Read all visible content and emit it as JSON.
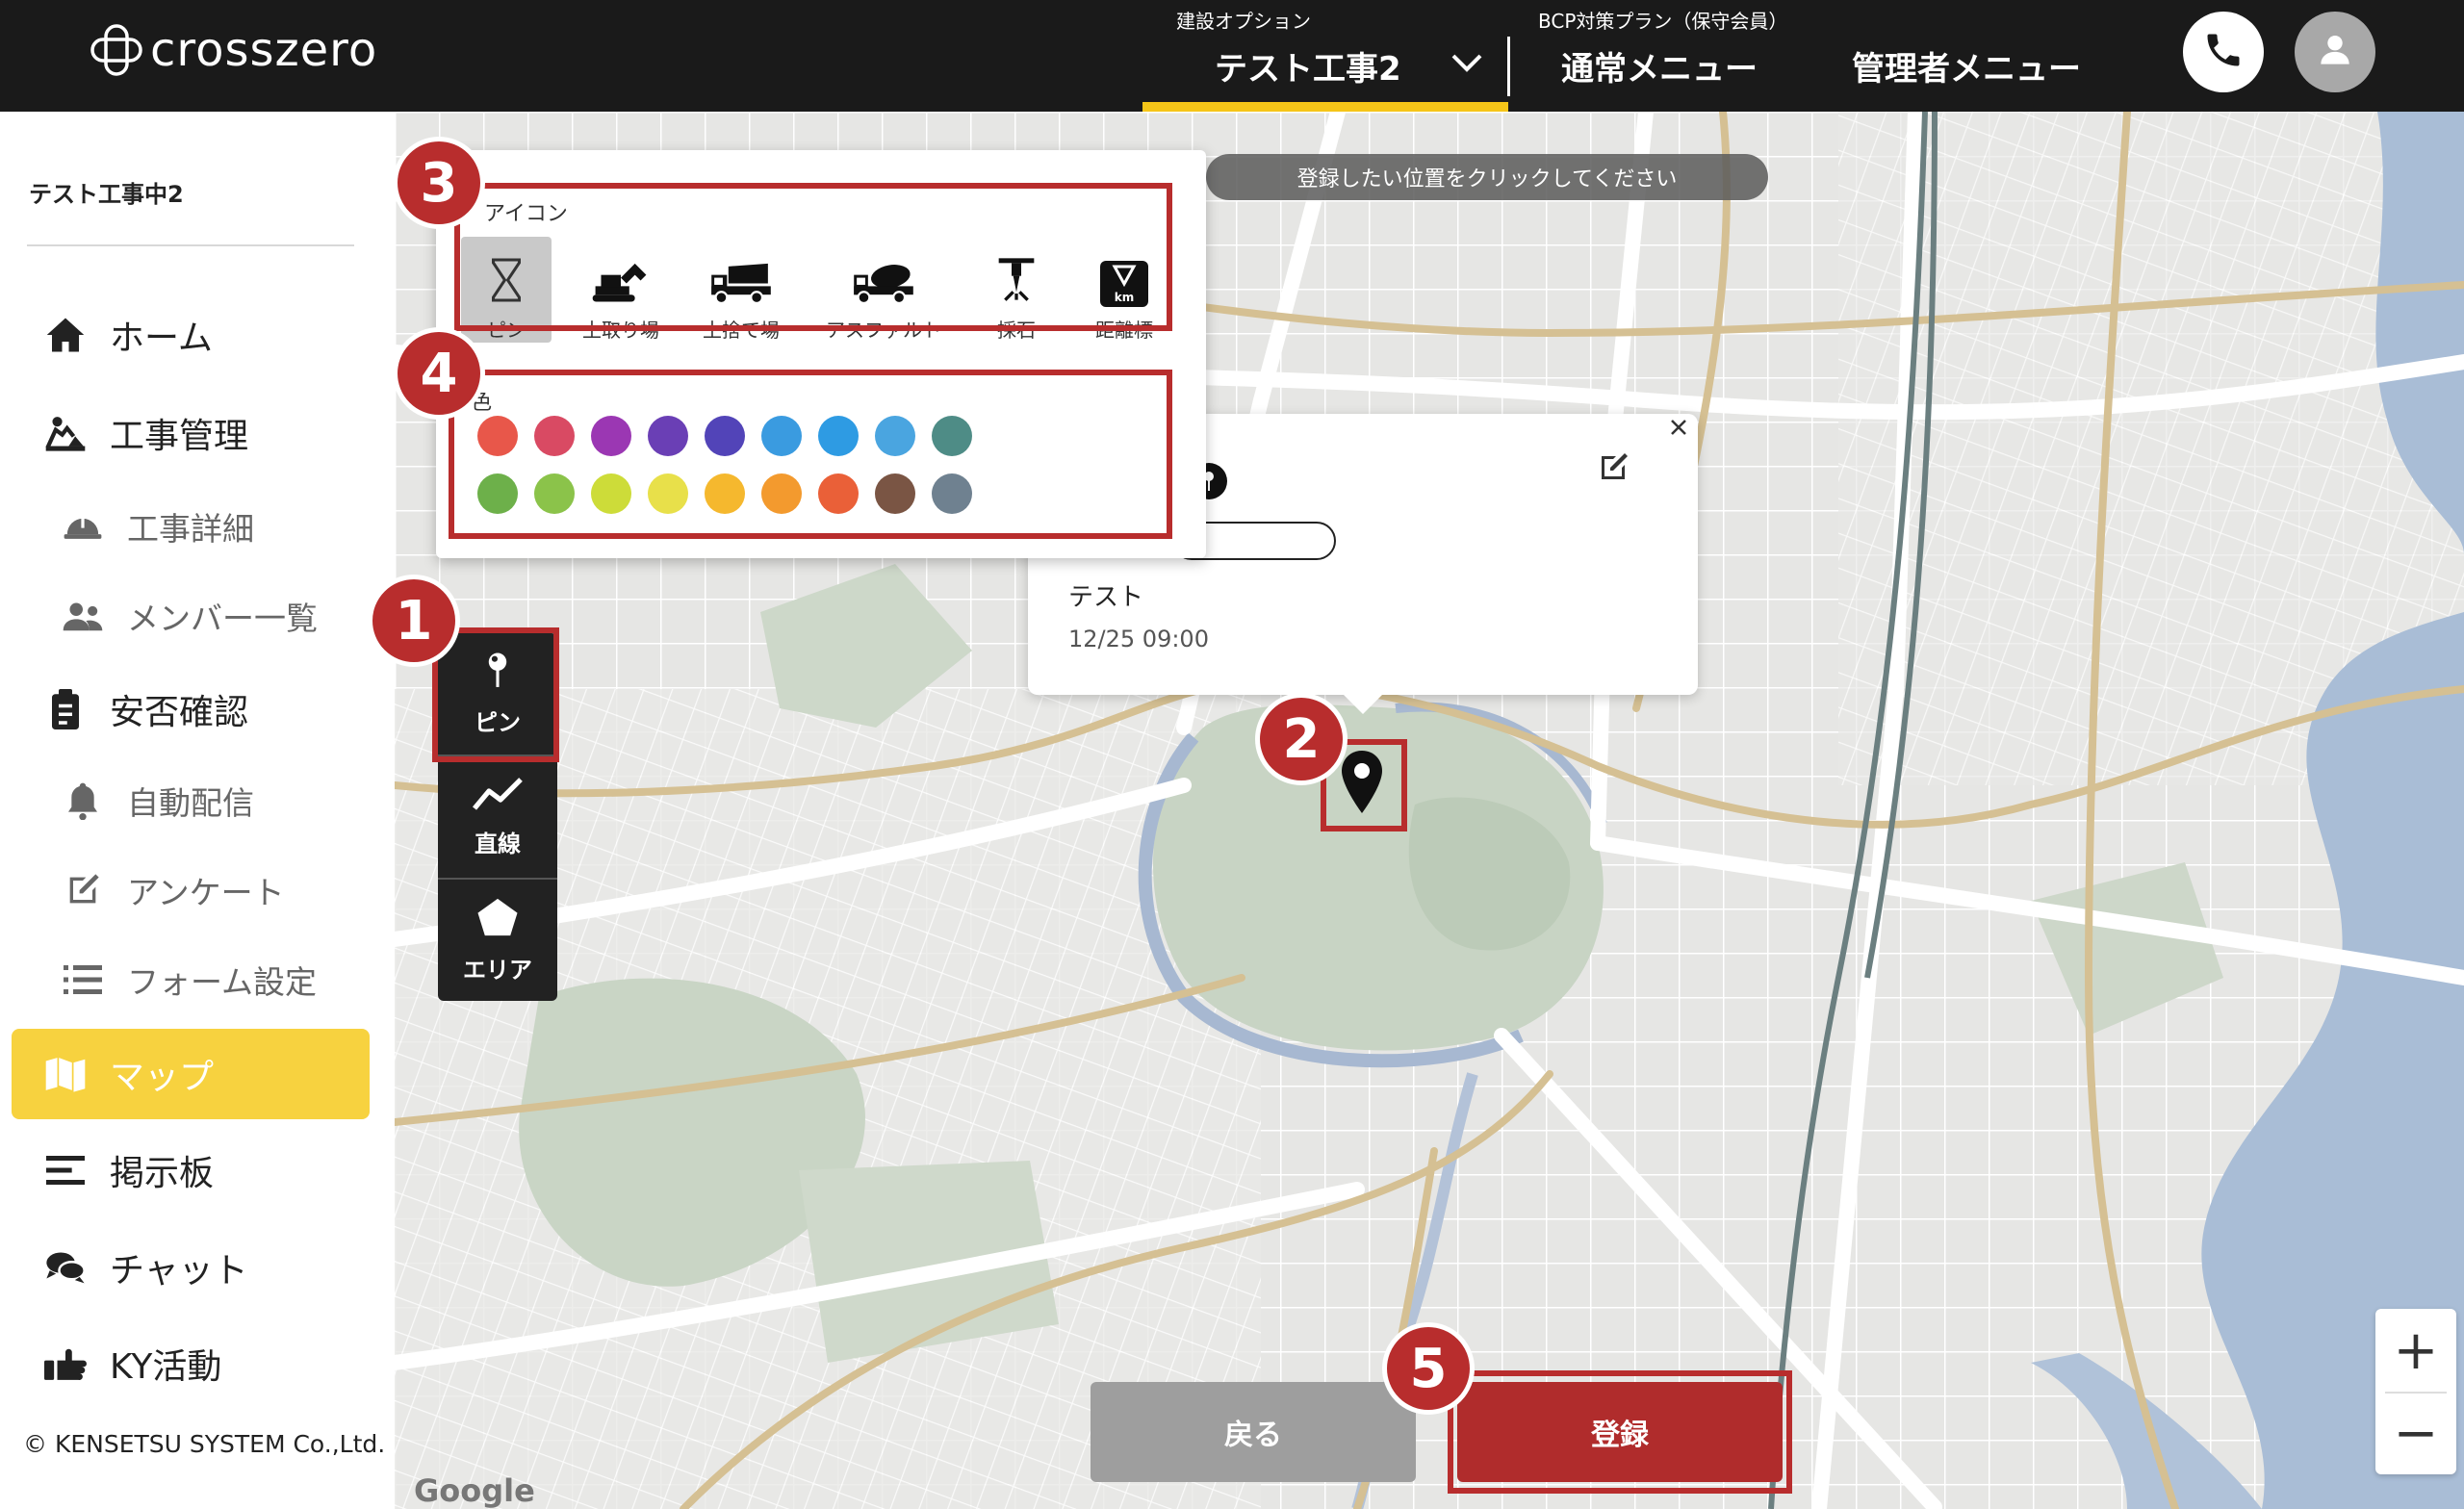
{
  "app": {
    "brand": "crosszero",
    "copyright": "© KENSETSU SYSTEM Co.,Ltd."
  },
  "header": {
    "project_caption": "建設オプション",
    "project_name": "テスト工事2",
    "plan_caption": "BCP対策プラン（保守会員）",
    "normal_menu": "通常メニュー",
    "admin_menu": "管理者メニュー",
    "icons": [
      "phone-icon",
      "user-avatar-icon"
    ]
  },
  "sidebar": {
    "project_label": "テスト工事中2",
    "items": [
      {
        "label": "ホーム",
        "icon": "home-icon"
      },
      {
        "label": "工事管理",
        "icon": "construction-icon"
      },
      {
        "label": "工事詳細",
        "icon": "helmet-icon"
      },
      {
        "label": "メンバー一覧",
        "icon": "users-icon"
      },
      {
        "label": "安否確認",
        "icon": "clipboard-icon"
      },
      {
        "label": "自動配信",
        "icon": "bell-icon"
      },
      {
        "label": "アンケート",
        "icon": "edit-icon"
      },
      {
        "label": "フォーム設定",
        "icon": "list-icon"
      },
      {
        "label": "マップ",
        "icon": "map-icon",
        "active": true
      },
      {
        "label": "掲示板",
        "icon": "board-icon"
      },
      {
        "label": "チャット",
        "icon": "chat-icon"
      },
      {
        "label": "KY活動",
        "icon": "thumbs-up-icon"
      }
    ]
  },
  "map": {
    "hint": "登録したい位置をクリックしてください",
    "icon_section_label": "アイコン",
    "color_section_label": "色",
    "icons": [
      {
        "label": "ピン",
        "icon": "hourglass-pin-icon",
        "selected": true
      },
      {
        "label": "土取り場",
        "icon": "excavator-icon"
      },
      {
        "label": "土捨て場",
        "icon": "dump-truck-icon"
      },
      {
        "label": "アスファルト",
        "icon": "mixer-truck-icon"
      },
      {
        "label": "採石",
        "icon": "drill-icon"
      },
      {
        "label": "距離標",
        "icon": "distance-marker-icon",
        "badge": "km"
      }
    ],
    "colors_row1": [
      "#e8574a",
      "#d94a63",
      "#9b37b3",
      "#6a3fb5",
      "#5244b8",
      "#3a9be0",
      "#2e9be3",
      "#4aa5e0",
      "#4e8c86"
    ],
    "colors_row2": [
      "#6db04a",
      "#8bc34a",
      "#cddc39",
      "#e8e04a",
      "#f5b82e",
      "#f39a2e",
      "#ea6038",
      "#7a5544",
      "#6f8190"
    ],
    "popup": {
      "title": "テスト",
      "time": "12/25 09:00"
    },
    "draw_tools": [
      {
        "label": "ピン",
        "icon": "pin-icon"
      },
      {
        "label": "直線",
        "icon": "polyline-icon"
      },
      {
        "label": "エリア",
        "icon": "pentagon-icon"
      }
    ],
    "back_label": "戻る",
    "register_label": "登録",
    "zoom_in": "+",
    "zoom_out": "−",
    "attribution": "Google",
    "badges": [
      "1",
      "2",
      "3",
      "4",
      "5"
    ]
  }
}
